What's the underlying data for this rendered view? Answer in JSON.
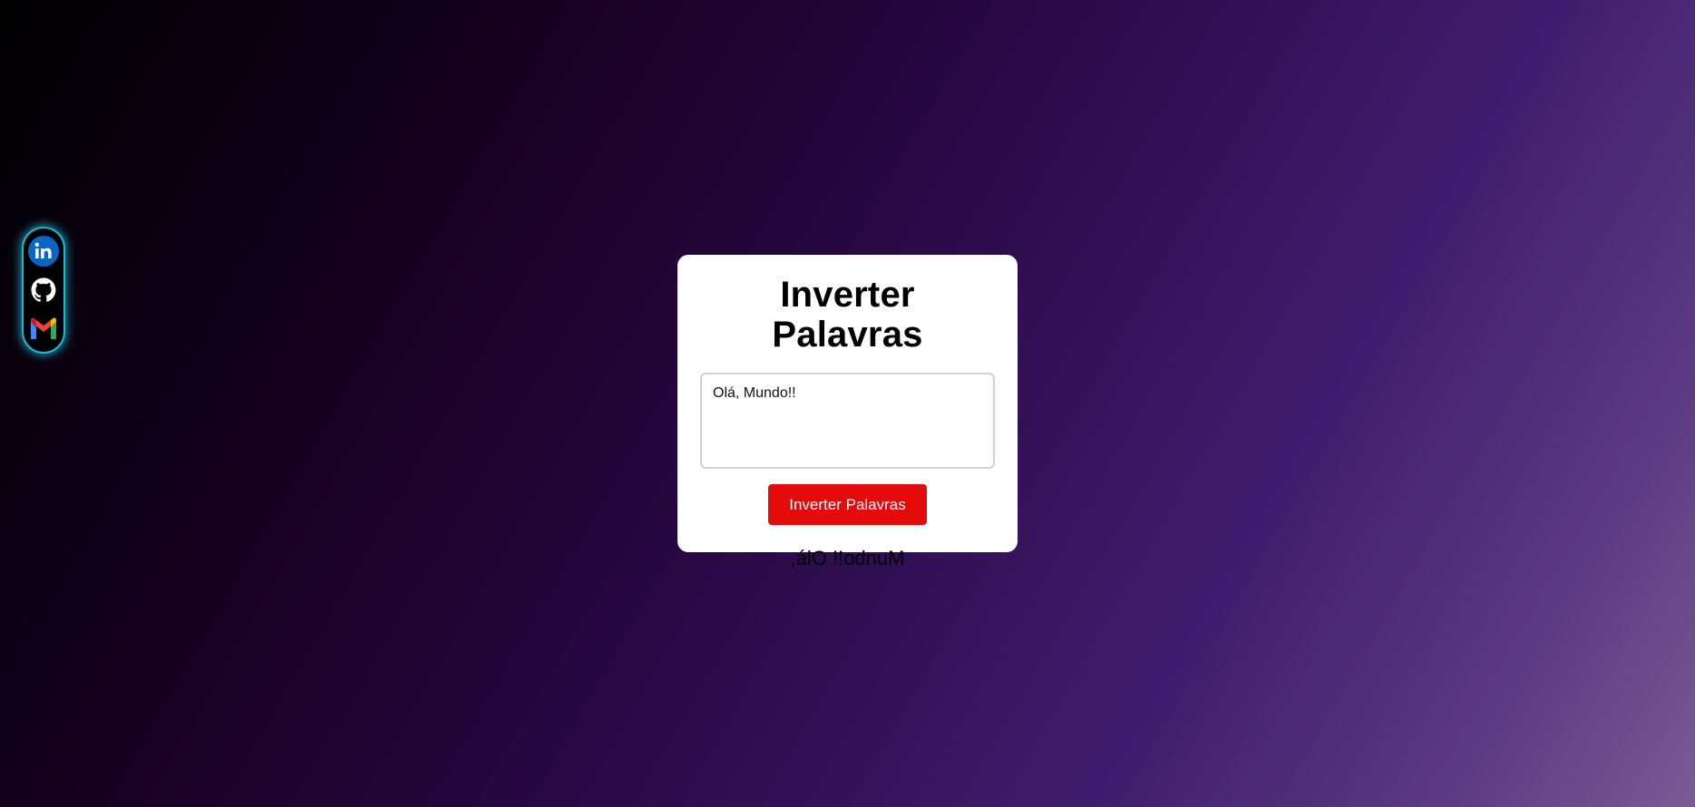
{
  "social": [
    {
      "name": "linkedin",
      "icon": "linkedin-icon",
      "color": "#0a66c2"
    },
    {
      "name": "github",
      "icon": "github-icon",
      "color": "#ffffff"
    },
    {
      "name": "gmail",
      "icon": "gmail-icon",
      "color": "#ea4335"
    }
  ],
  "app": {
    "title": "Inverter Palavras",
    "input_value": "Olá, Mundo!!",
    "button_label": "Inverter Palavras",
    "result": ",álO !!odnuM"
  },
  "colors": {
    "button": "#e50b0b",
    "social_glow": "#1fb6d4",
    "card": "#ffffff"
  }
}
